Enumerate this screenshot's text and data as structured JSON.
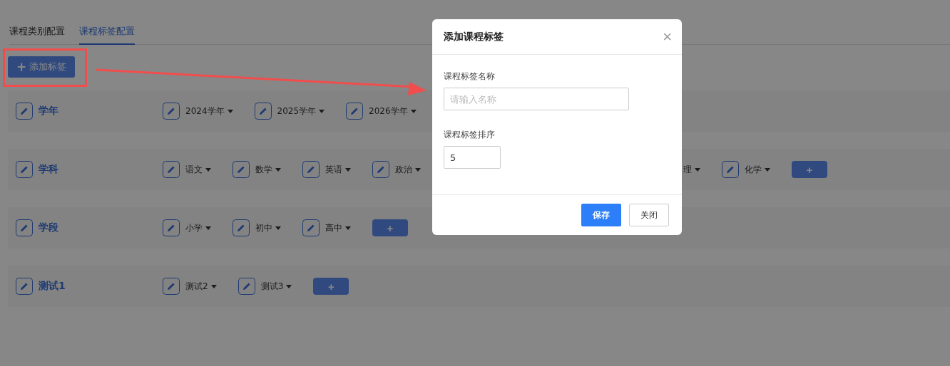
{
  "tabs": [
    {
      "label": "课程类别配置",
      "selected": false
    },
    {
      "label": "课程标签配置",
      "selected": true
    }
  ],
  "add_button": {
    "icon": "+",
    "label": "添加标签"
  },
  "categories": [
    {
      "name": "学年",
      "tags": [
        {
          "kind": "tag",
          "label": "2024学年"
        },
        {
          "kind": "tag",
          "label": "2025学年"
        },
        {
          "kind": "tag",
          "label": "2026学年"
        }
      ]
    },
    {
      "name": "学科",
      "tags": [
        {
          "kind": "tag",
          "label": "语文"
        },
        {
          "kind": "tag",
          "label": "数学"
        },
        {
          "kind": "tag",
          "label": "英语"
        },
        {
          "kind": "tag",
          "label": "政治"
        }
      ],
      "after_dialog": [
        {
          "kind": "cut",
          "label": "理"
        },
        {
          "kind": "tag",
          "label": "化学"
        },
        {
          "kind": "add",
          "label": "+"
        }
      ]
    },
    {
      "name": "学段",
      "tags": [
        {
          "kind": "tag",
          "label": "小学"
        },
        {
          "kind": "tag",
          "label": "初中"
        },
        {
          "kind": "tag",
          "label": "高中"
        },
        {
          "kind": "add",
          "label": "+"
        }
      ]
    },
    {
      "name": "测试1",
      "tags": [
        {
          "kind": "tag",
          "label": "测试2"
        },
        {
          "kind": "tag",
          "label": "测试3"
        },
        {
          "kind": "add",
          "label": "+"
        }
      ]
    }
  ],
  "dialog": {
    "title": "添加课程标签",
    "close_icon": "×",
    "fields": [
      {
        "label": "课程标签名称",
        "placeholder": "请输入名称",
        "kind": "wide"
      },
      {
        "label": "课程标签排序",
        "value": "5",
        "kind": "narrow"
      }
    ],
    "buttons": [
      {
        "label": "保存",
        "kind": "primary"
      },
      {
        "label": "关闭",
        "kind": "default"
      }
    ]
  }
}
